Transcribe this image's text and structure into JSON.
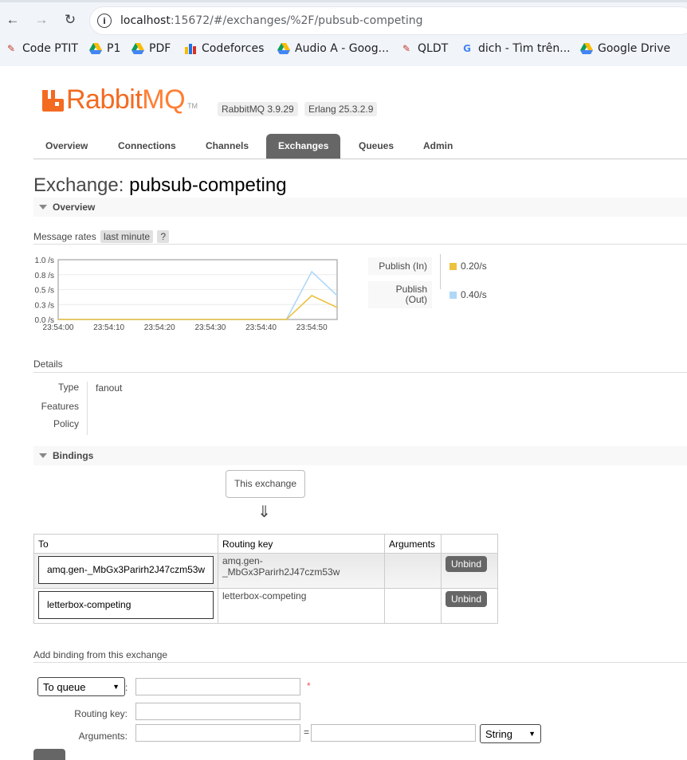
{
  "browser": {
    "url_host": "localhost",
    "url_rest": ":15672/#/exchanges/%2F/pubsub-competing",
    "bookmarks": [
      {
        "label": "Code PTIT",
        "icon": "code-ptit-icon"
      },
      {
        "label": "P1",
        "icon": "google-drive-icon"
      },
      {
        "label": "PDF",
        "icon": "google-drive-icon"
      },
      {
        "label": "Codeforces",
        "icon": "codeforces-icon"
      },
      {
        "label": "Audio A - Goog...",
        "icon": "google-drive-icon"
      },
      {
        "label": "QLDT",
        "icon": "qldt-icon"
      },
      {
        "label": "dich - Tìm trên...",
        "icon": "google-icon"
      },
      {
        "label": "Google Drive",
        "icon": "google-drive-icon"
      }
    ]
  },
  "header": {
    "logo_rabbit": "Rabbit",
    "logo_mq": "MQ",
    "logo_tm": "TM",
    "rabbitmq_version": "RabbitMQ 3.9.29",
    "erlang_version": "Erlang 25.3.2.9"
  },
  "tabs": [
    {
      "label": "Overview",
      "active": false
    },
    {
      "label": "Connections",
      "active": false
    },
    {
      "label": "Channels",
      "active": false
    },
    {
      "label": "Exchanges",
      "active": true
    },
    {
      "label": "Queues",
      "active": false
    },
    {
      "label": "Admin",
      "active": false
    }
  ],
  "page": {
    "title_prefix": "Exchange:",
    "title_name": "pubsub-competing"
  },
  "overview": {
    "section_title": "Overview",
    "message_rates_label": "Message rates",
    "range_button": "last minute",
    "help_button": "?",
    "legend": [
      {
        "label": "Publish (In)",
        "value": "0.20/s",
        "color": "#edc240"
      },
      {
        "label": "Publish (Out)",
        "value": "0.40/s",
        "color": "#afd8f8"
      }
    ]
  },
  "chart_data": {
    "type": "line",
    "x": [
      "23:54:00",
      "23:54:05",
      "23:54:10",
      "23:54:15",
      "23:54:20",
      "23:54:25",
      "23:54:30",
      "23:54:35",
      "23:54:40",
      "23:54:45",
      "23:54:50",
      "23:54:55"
    ],
    "x_tick_labels": [
      "23:54:00",
      "23:54:10",
      "23:54:20",
      "23:54:30",
      "23:54:40",
      "23:54:50"
    ],
    "y_tick_labels": [
      "1.0 /s",
      "0.8 /s",
      "0.5 /s",
      "0.3 /s",
      "0.0 /s"
    ],
    "ylim": [
      0,
      1.0
    ],
    "series": [
      {
        "name": "Publish (In)",
        "color": "#edc240",
        "values": [
          0,
          0,
          0,
          0,
          0,
          0,
          0,
          0,
          0,
          0,
          0.4,
          0.2
        ]
      },
      {
        "name": "Publish (Out)",
        "color": "#afd8f8",
        "values": [
          0,
          0,
          0,
          0,
          0,
          0,
          0,
          0,
          0,
          0,
          0.8,
          0.4
        ]
      }
    ],
    "grid": true
  },
  "details": {
    "heading": "Details",
    "type_label": "Type",
    "type_value": "fanout",
    "features_label": "Features",
    "policy_label": "Policy"
  },
  "bindings": {
    "section_title": "Bindings",
    "this_exchange": "This exchange",
    "arrow": "⇓",
    "columns": [
      "To",
      "Routing key",
      "Arguments",
      ""
    ],
    "rows": [
      {
        "to": "amq.gen-_MbGx3Parirh2J47czm53w",
        "routing_key": "amq.gen-_MbGx3Parirh2J47czm53w",
        "arguments": "",
        "action": "Unbind"
      },
      {
        "to": "letterbox-competing",
        "routing_key": "letterbox-competing",
        "arguments": "",
        "action": "Unbind"
      }
    ]
  },
  "add_binding": {
    "heading": "Add binding from this exchange",
    "destination_type": "To queue",
    "destination_value": "",
    "required_mark": "*",
    "routing_key_label": "Routing key:",
    "routing_key_value": "",
    "arguments_label": "Arguments:",
    "argument_key": "",
    "equals": "=",
    "argument_value": "",
    "argument_type": "String",
    "colon": ":"
  }
}
